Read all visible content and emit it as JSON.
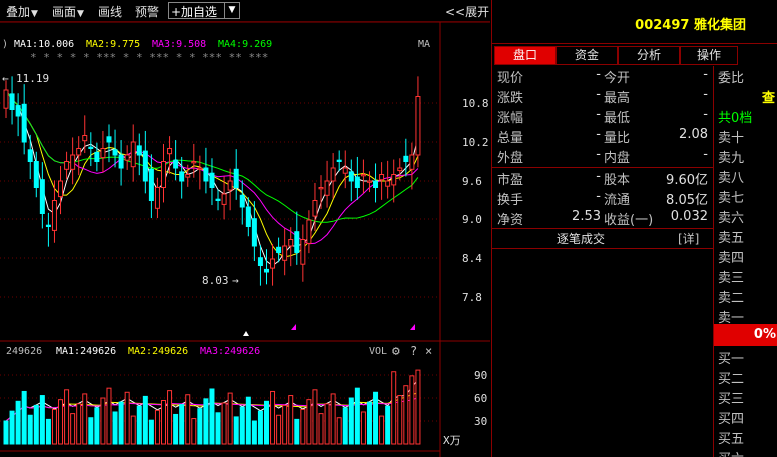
{
  "toolbar": {
    "overlay_label": "叠加",
    "layout_label": "画面",
    "draw_label": "画线",
    "alert_label": "预警",
    "add_fav_label": "+加自选",
    "expand_label": "<<展开"
  },
  "main_chart": {
    "ma_header_prefix": ")",
    "ma1": "MA1:10.006",
    "ma2": "MA2:9.775",
    "ma3": "MA3:9.508",
    "ma4": "MA4:9.269",
    "ma_right_label": "MA",
    "star_markers": "* * * * * *** * *  ***  * * ***  **  ***",
    "high_label": "11.19",
    "low_label": "8.03",
    "y_ticks": [
      "10.8",
      "10.2",
      "9.6",
      "9.0",
      "8.4",
      "7.8"
    ],
    "colors": {
      "ma1": "#ffffff",
      "ma2": "#ffff00",
      "ma3": "#ff00ff",
      "ma4": "#00ff00",
      "up": "#ff3333",
      "down": "#00ffff"
    }
  },
  "volume_chart": {
    "vol_prefix": "249626",
    "ma1": "MA1:249626",
    "ma2": "MA2:249626",
    "ma3": "MA3:249626",
    "indicator_label": "VOL",
    "y_ticks": [
      "90",
      "60",
      "30"
    ],
    "unit_label": "X万"
  },
  "stock": {
    "code": "002497",
    "name": "雅化集团"
  },
  "tabs": [
    {
      "label": "盘口",
      "active": true
    },
    {
      "label": "资金",
      "active": false
    },
    {
      "label": "分析",
      "active": false
    },
    {
      "label": "操作",
      "active": false
    }
  ],
  "quote": [
    {
      "l1": "现价",
      "v1": "-",
      "l2": "今开",
      "v2": "-"
    },
    {
      "l1": "涨跌",
      "v1": "-",
      "l2": "最高",
      "v2": "-"
    },
    {
      "l1": "涨幅",
      "v1": "-",
      "l2": "最低",
      "v2": "-"
    },
    {
      "l1": "总量",
      "v1": "-",
      "l2": "量比",
      "v2": "2.08"
    },
    {
      "l1": "外盘",
      "v1": "-",
      "l2": "内盘",
      "v2": "-"
    },
    {
      "l1": "市盈",
      "v1": "-",
      "l2": "股本",
      "v2": "9.60亿"
    },
    {
      "l1": "换手",
      "v1": "-",
      "l2": "流通",
      "v2": "8.05亿"
    },
    {
      "l1": "净资",
      "v1": "2.53",
      "l2": "收益(一)",
      "v2": "0.032"
    }
  ],
  "trade_link": {
    "label": "逐笔成交",
    "detail": "[详]"
  },
  "order_book": {
    "header": "委比",
    "query": "查",
    "total": "共0档",
    "sells": [
      "卖十",
      "卖九",
      "卖八",
      "卖七",
      "卖六",
      "卖五",
      "卖四",
      "卖三",
      "卖二",
      "卖一"
    ],
    "ratio": "0%",
    "buys": [
      "买一",
      "买二",
      "买三",
      "买四",
      "买五",
      "买六"
    ]
  }
}
